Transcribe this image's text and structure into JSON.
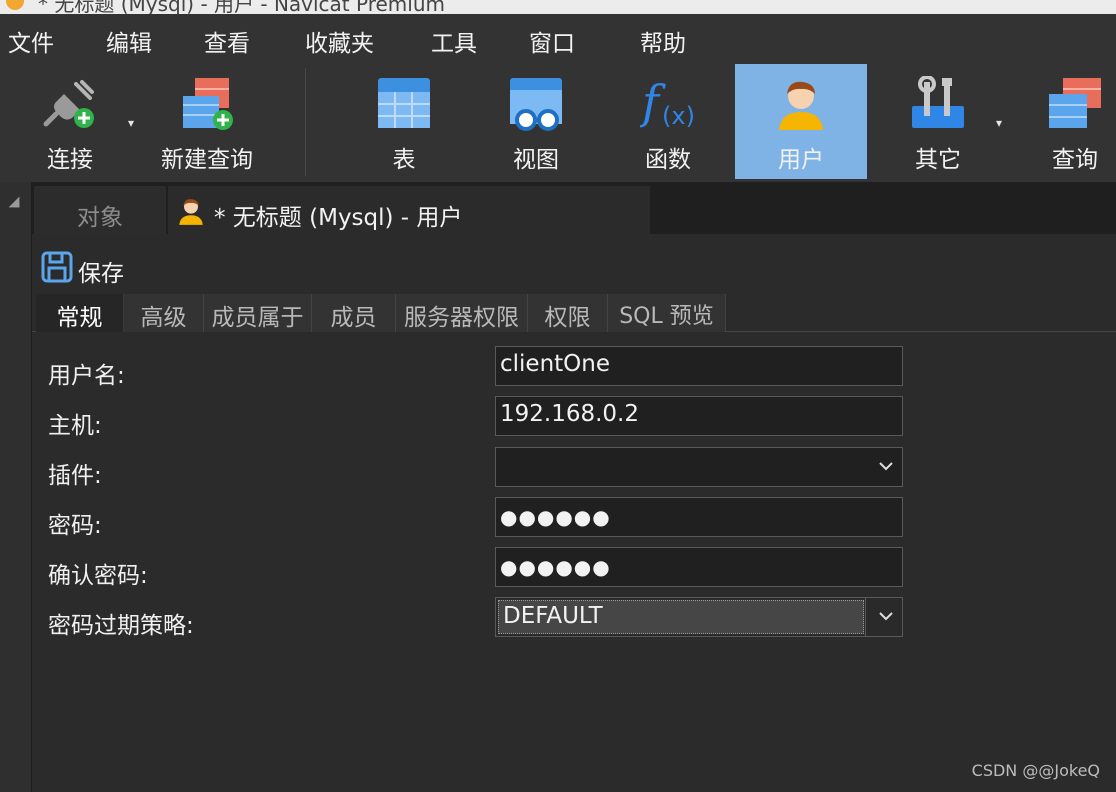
{
  "window": {
    "title": "* 无标题 (Mysql) - 用户 - Navicat Premium"
  },
  "menu": [
    "文件",
    "编辑",
    "查看",
    "收藏夹",
    "工具",
    "窗口",
    "帮助"
  ],
  "toolbar": {
    "connect": "连接",
    "new_query": "新建查询",
    "table": "表",
    "view": "视图",
    "function": "函数",
    "user": "用户",
    "other": "其它",
    "query": "查询"
  },
  "tabs": {
    "objects": "对象",
    "document": "* 无标题 (Mysql) - 用户"
  },
  "save_label": "保存",
  "subtabs": [
    "常规",
    "高级",
    "成员属于",
    "成员",
    "服务器权限",
    "权限",
    "SQL 预览"
  ],
  "form": {
    "username_label": "用户名:",
    "username_value": "clientOne",
    "host_label": "主机:",
    "host_value": "192.168.0.2",
    "plugin_label": "插件:",
    "plugin_value": "",
    "password_label": "密码:",
    "password_value": "●●●●●●",
    "confirm_label": "确认密码:",
    "confirm_value": "●●●●●●",
    "expire_label": "密码过期策略:",
    "expire_value": "DEFAULT"
  },
  "watermark": "CSDN @@JokeQ",
  "colors": {
    "accent": "#7fb3e6",
    "background": "#2b2b2b",
    "toolbar": "#333333"
  }
}
